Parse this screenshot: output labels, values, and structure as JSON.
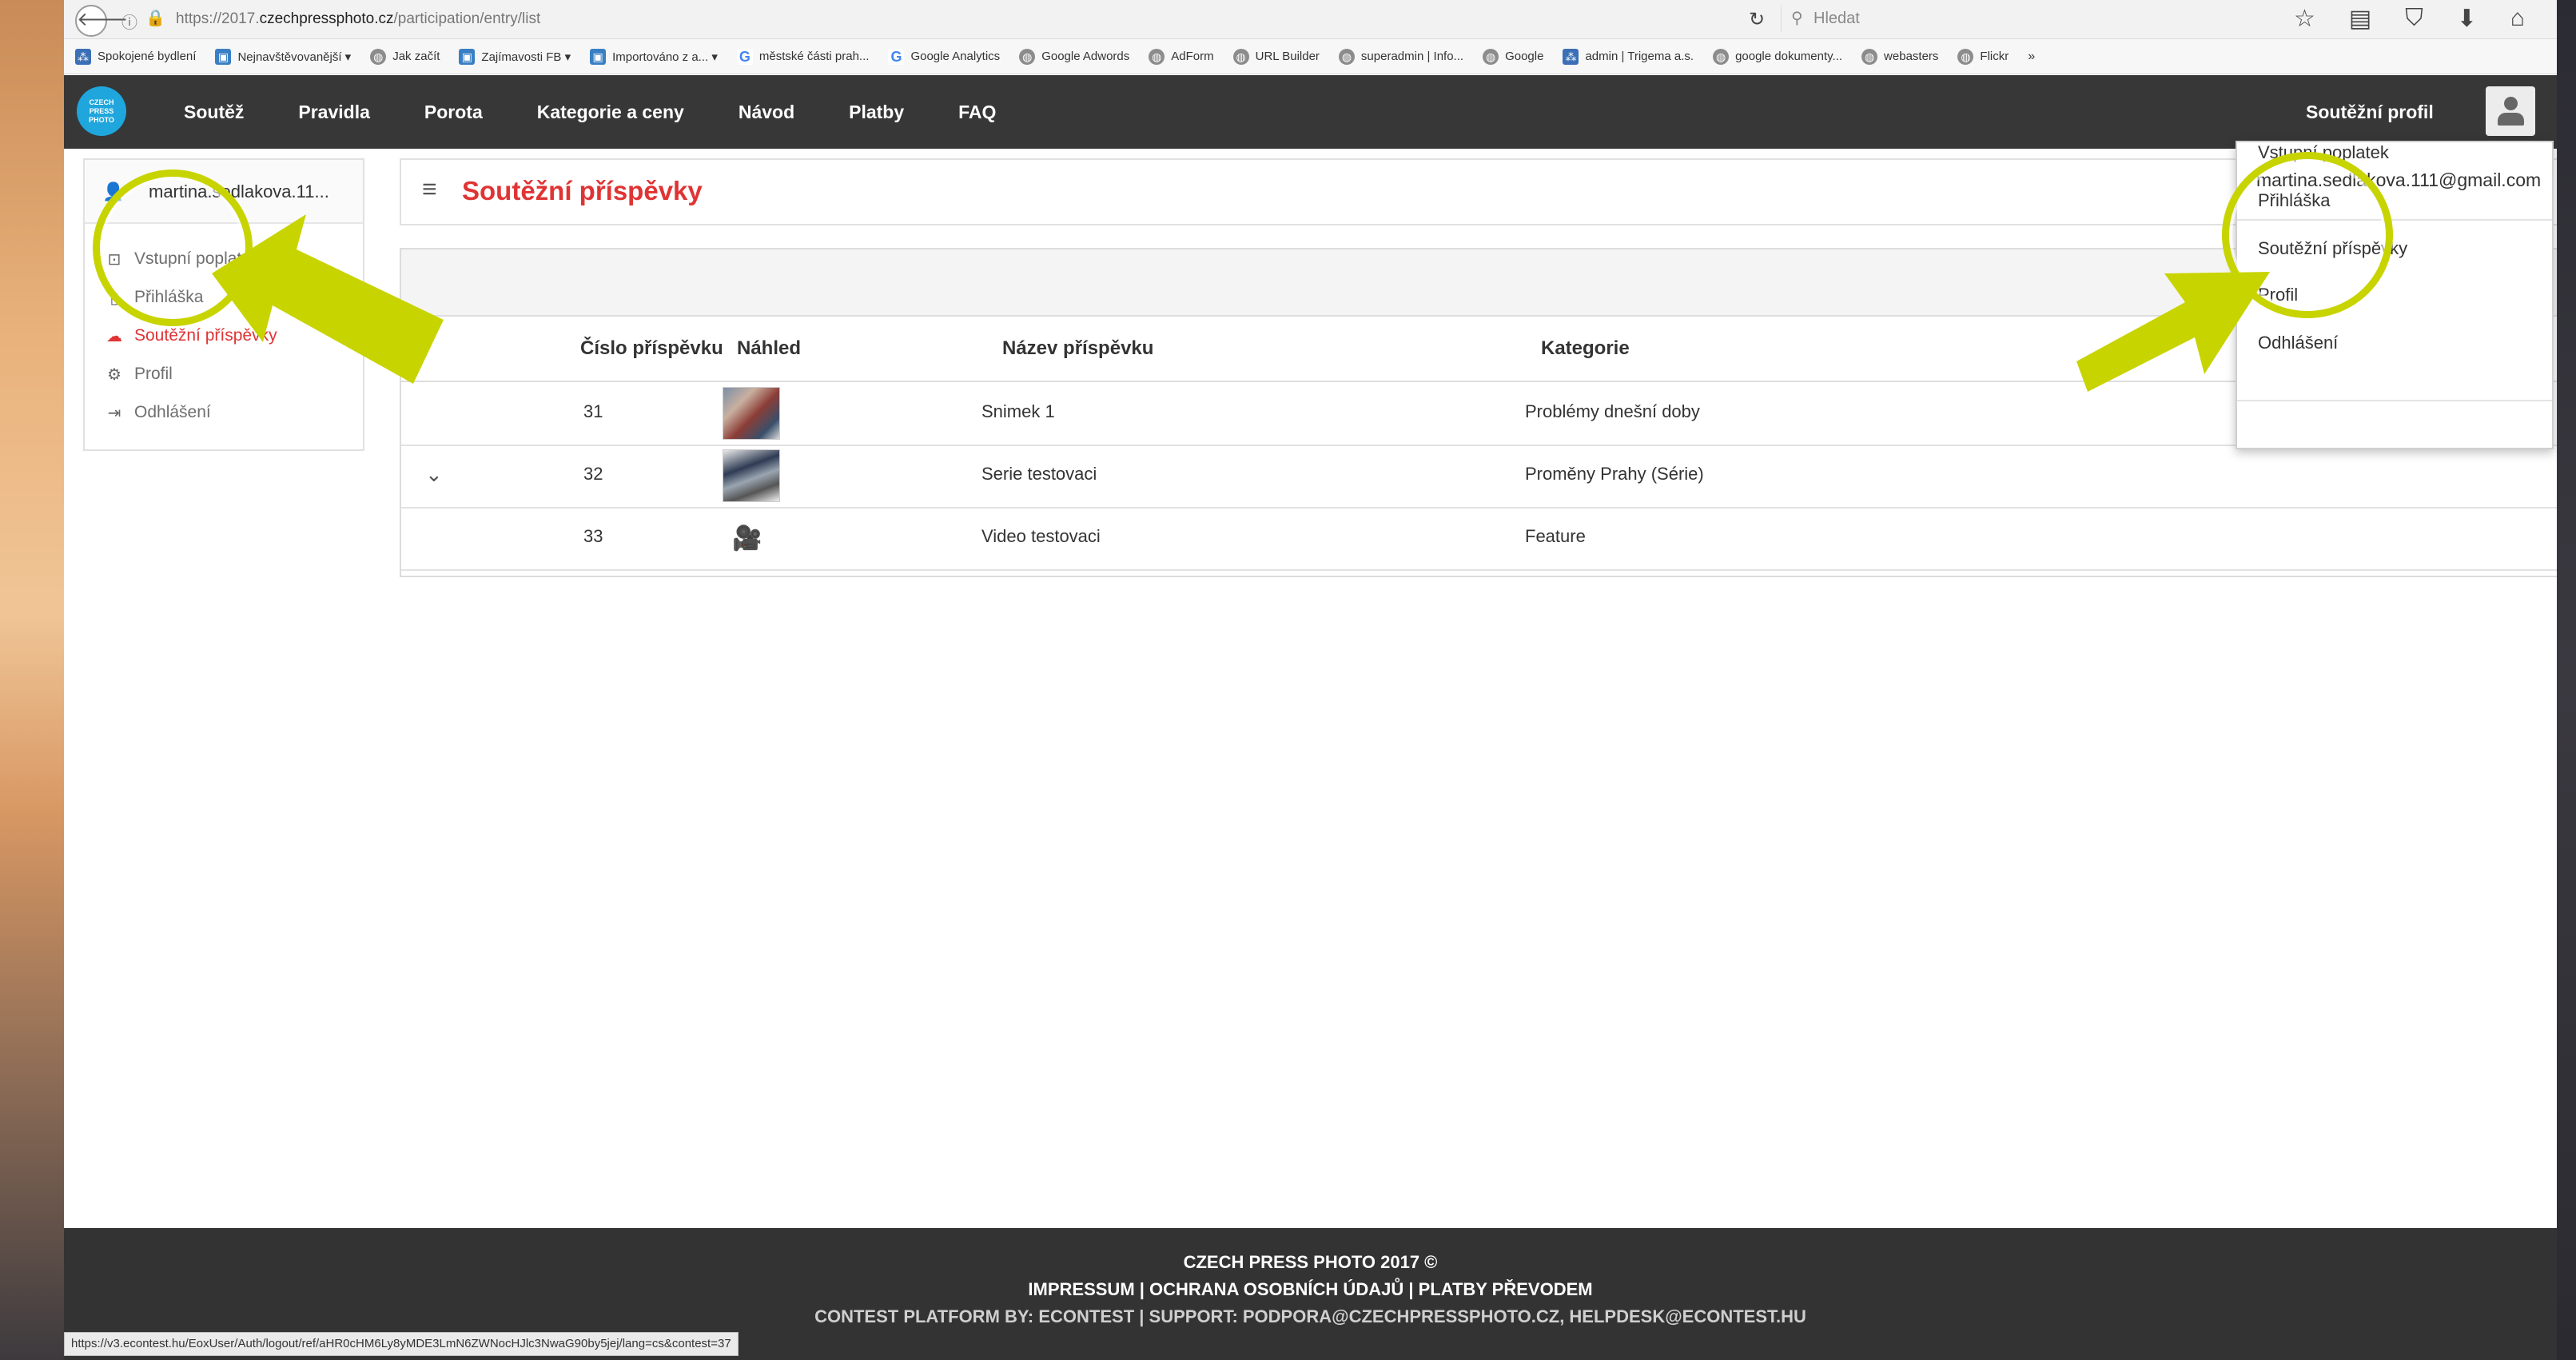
{
  "browser": {
    "url_prefix": "https://2017.",
    "url_domain": "czechpressphoto.cz",
    "url_path": "/participation/entry/list",
    "search_placeholder": "Hledat",
    "bookmarks": [
      {
        "label": "Spokojené bydlení",
        "icon": "network-icon"
      },
      {
        "label": "Nejnavštěvovanější ▾",
        "icon": "folder-icon"
      },
      {
        "label": "Jak začít",
        "icon": "globe-icon"
      },
      {
        "label": "Zajímavosti FB ▾",
        "icon": "folder-icon"
      },
      {
        "label": "Importováno z a... ▾",
        "icon": "folder-icon"
      },
      {
        "label": "městské části prah...",
        "icon": "google-icon"
      },
      {
        "label": "Google Analytics",
        "icon": "google-icon"
      },
      {
        "label": "Google Adwords",
        "icon": "globe-icon"
      },
      {
        "label": "AdForm",
        "icon": "globe-icon"
      },
      {
        "label": "URL Builder",
        "icon": "globe-icon"
      },
      {
        "label": "superadmin | Info...",
        "icon": "globe-icon"
      },
      {
        "label": "Google",
        "icon": "globe-icon"
      },
      {
        "label": "admin | Trigema a.s.",
        "icon": "network-icon"
      },
      {
        "label": "google dokumenty...",
        "icon": "globe-icon"
      },
      {
        "label": "webasters",
        "icon": "globe-icon"
      },
      {
        "label": "Flickr",
        "icon": "globe-icon"
      }
    ],
    "status_url": "https://v3.econtest.hu/EoxUser/Auth/logout/ref/aHR0cHM6Ly8yMDE3LmN6ZWNocHJlc3NwaG90by5jej/lang=cs&contest=37"
  },
  "site_nav": {
    "logo_text": "CZECH PRESS PHOTO",
    "items": [
      "Soutěž",
      "Pravidla",
      "Porota",
      "Kategorie a ceny",
      "Návod",
      "Platby",
      "FAQ"
    ],
    "profile_label": "Soutěžní profil"
  },
  "sidebar": {
    "username": "martina.sedlakova.11...",
    "items": [
      {
        "label": "Vstupní poplatek",
        "icon": "ticket-icon",
        "active": false
      },
      {
        "label": "Přihláška",
        "icon": "document-icon",
        "active": false
      },
      {
        "label": "Soutěžní příspěvky",
        "icon": "upload-icon",
        "active": true
      },
      {
        "label": "Profil",
        "icon": "gears-icon",
        "active": false
      },
      {
        "label": "Odhlášení",
        "icon": "logout-icon",
        "active": false
      }
    ]
  },
  "main": {
    "title": "Soutěžní příspěvky",
    "columns": [
      "Číslo příspěvku",
      "Náhled",
      "Název příspěvku",
      "Kategorie"
    ],
    "rows": [
      {
        "number": "31",
        "preview": "image",
        "name": "Snimek 1",
        "category": "Problémy dnešní doby",
        "expand": false
      },
      {
        "number": "32",
        "preview": "image",
        "name": "Serie testovaci",
        "category": "Proměny Prahy (Série)",
        "expand": true
      },
      {
        "number": "33",
        "preview": "video",
        "name": "Video testovaci",
        "category": "Feature",
        "expand": false
      }
    ]
  },
  "dropdown": {
    "email": "martina.sedlakova.111@gmail.com",
    "items": [
      "Vstupní poplatek",
      "Přihláška",
      "Soutěžní příspěvky",
      "Profil",
      "Odhlášení"
    ]
  },
  "footer": {
    "line1": "CZECH PRESS PHOTO 2017 ©",
    "line2": "IMPRESSUM | OCHRANA OSOBNÍCH ÚDAJŮ | PLATBY PŘEVODEM",
    "line3": "CONTEST PLATFORM BY: ECONTEST | SUPPORT: PODPORA@CZECHPRESSPHOTO.CZ, HELPDESK@ECONTEST.HU"
  },
  "colors": {
    "accent_red": "#e03434",
    "annotation": "#c8d400",
    "nav_bg": "#373737",
    "logo_blue": "#1fa6dc"
  }
}
